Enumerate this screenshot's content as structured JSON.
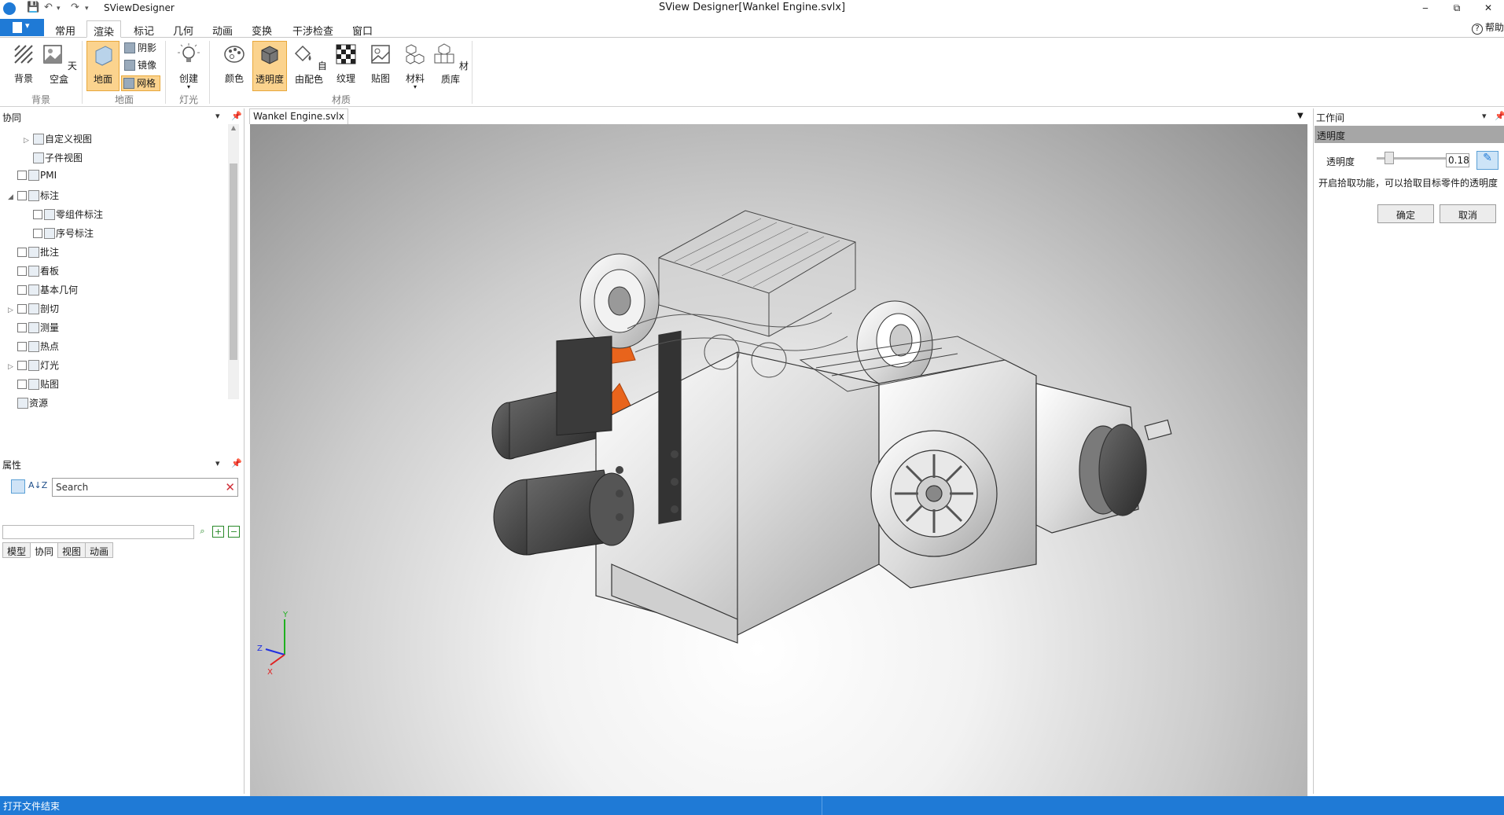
{
  "titlebar": {
    "app_name": "SViewDesigner",
    "window_title": "SView Designer[Wankel Engine.svlx]",
    "minimize": "‒",
    "restore": "⧉",
    "close": "✕"
  },
  "ribbon_tabs": [
    "常用",
    "渲染",
    "标记",
    "几何",
    "动画",
    "变换",
    "干涉检查",
    "窗口"
  ],
  "active_tab": "渲染",
  "help_label": "帮助",
  "ribbon": {
    "bg_btn": "背景",
    "skybox_btn": "天空盒",
    "ground_btn": "地面",
    "shadow_btn": "阴影",
    "mirror_btn": "镜像",
    "grid_btn": "网格",
    "create_btn": "创建",
    "color_btn": "颜色",
    "transparency_btn": "透明度",
    "free_color_btn": "自由配色",
    "texture_btn": "纹理",
    "decal_btn": "贴图",
    "material_btn": "材料",
    "material_lib_btn": "材质库",
    "groups": [
      "背景",
      "地面",
      "灯光",
      "材质"
    ]
  },
  "left_panel": {
    "title": "协同",
    "tree": [
      {
        "label": "自定义视图",
        "indent": 1,
        "expander": "▷",
        "checkbox": false
      },
      {
        "label": "子件视图",
        "indent": 1,
        "expander": "",
        "checkbox": false
      },
      {
        "label": "PMI",
        "indent": 0,
        "expander": "",
        "checkbox": true
      },
      {
        "label": "标注",
        "indent": 0,
        "expander": "◢",
        "checkbox": true
      },
      {
        "label": "零组件标注",
        "indent": 1,
        "expander": "",
        "checkbox": true
      },
      {
        "label": "序号标注",
        "indent": 1,
        "expander": "",
        "checkbox": true
      },
      {
        "label": "批注",
        "indent": 0,
        "expander": "",
        "checkbox": true
      },
      {
        "label": "看板",
        "indent": 0,
        "expander": "",
        "checkbox": true
      },
      {
        "label": "基本几何",
        "indent": 0,
        "expander": "",
        "checkbox": true
      },
      {
        "label": "剖切",
        "indent": 0,
        "expander": "▷",
        "checkbox": true
      },
      {
        "label": "测量",
        "indent": 0,
        "expander": "",
        "checkbox": true
      },
      {
        "label": "热点",
        "indent": 0,
        "expander": "",
        "checkbox": true
      },
      {
        "label": "灯光",
        "indent": 0,
        "expander": "▷",
        "checkbox": true
      },
      {
        "label": "贴图",
        "indent": 0,
        "expander": "",
        "checkbox": true
      },
      {
        "label": "资源",
        "indent": 0,
        "expander": "",
        "checkbox": false
      }
    ],
    "tabs": [
      "模型",
      "协同",
      "视图",
      "动画"
    ],
    "active_tab": "协同"
  },
  "properties_panel": {
    "title": "属性",
    "search_placeholder": "Search",
    "sort_label": "A↓Z"
  },
  "document": {
    "tab_label": "Wankel Engine.svlx",
    "axis_labels": {
      "x": "X",
      "y": "Y",
      "z": "Z"
    }
  },
  "right_panel": {
    "title": "工作间",
    "section_title": "透明度",
    "slider_label": "透明度",
    "slider_value": "0.18",
    "slider_fraction": 0.18,
    "hint": "开启拾取功能，可以拾取目标零件的透明度",
    "ok": "确定",
    "cancel": "取消"
  },
  "status": {
    "message": "打开文件结束"
  },
  "colors": {
    "accent": "#1f7ad6",
    "active_button": "#fbd38e",
    "fan_orange": "#e8641c"
  }
}
